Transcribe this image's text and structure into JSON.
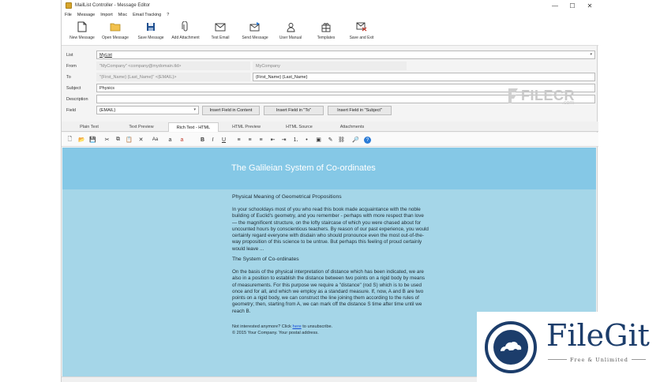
{
  "window": {
    "title": "MailList Controller - Message Editor",
    "controls": [
      "—",
      "☐",
      "✕"
    ]
  },
  "menu": [
    "File",
    "Message",
    "Import",
    "Misc",
    "Email Tracking",
    "?"
  ],
  "toolbar": [
    {
      "label": "New Message",
      "icon": "new-message-icon"
    },
    {
      "label": "Open Message",
      "icon": "open-folder-icon"
    },
    {
      "label": "Save Message",
      "icon": "save-icon"
    },
    {
      "label": "Add Attachment",
      "icon": "paperclip-icon"
    },
    {
      "label": "Test Email",
      "icon": "envelope-icon"
    },
    {
      "label": "Send Message",
      "icon": "send-message-icon"
    },
    {
      "label": "User Manual",
      "icon": "user-manual-icon"
    },
    {
      "label": "Templates",
      "icon": "templates-icon"
    },
    {
      "label": "Save and Exit",
      "icon": "save-exit-icon"
    }
  ],
  "form": {
    "list_label": "List",
    "list_value": "MyList",
    "from_label": "From",
    "from_value": "\"MyCompany\" <company@mydomain.tld>",
    "from_name": "MyCompany",
    "to_label": "To",
    "to_value": "\"{First_Name} {Last_Name}\" <{EMAIL}>",
    "to_name": "{First_Name} {Last_Name}",
    "subject_label": "Subject",
    "subject_value": "Physics",
    "description_label": "Description",
    "description_value": "",
    "field_label": "Field",
    "field_value": "{EMAIL}",
    "btn_insert_content": "Insert Field in Content",
    "btn_insert_to": "Insert Field in \"To\"",
    "btn_insert_subject": "Insert Field in \"Subject\""
  },
  "tabs": [
    "Plain Text",
    "Text Preview",
    "Rich Text - HTML",
    "HTML Preview",
    "HTML Source",
    "Attachments"
  ],
  "active_tab": "Rich Text - HTML",
  "format_toolbar": [
    {
      "name": "new-doc-icon",
      "glyph": "🗋"
    },
    {
      "name": "open-icon",
      "glyph": "📂"
    },
    {
      "name": "save-icon",
      "glyph": "💾"
    },
    {
      "name": "cut-icon",
      "glyph": "✂"
    },
    {
      "name": "copy-icon",
      "glyph": "⧉"
    },
    {
      "name": "paste-icon",
      "glyph": "📋"
    },
    {
      "name": "delete-icon",
      "glyph": "✕"
    },
    {
      "name": "font-size-icon",
      "glyph": "Aa"
    },
    {
      "name": "font-icon",
      "glyph": "a"
    },
    {
      "name": "font-color-icon",
      "glyph": "a"
    },
    {
      "name": "bold-icon",
      "glyph": "B"
    },
    {
      "name": "italic-icon",
      "glyph": "I"
    },
    {
      "name": "underline-icon",
      "glyph": "U"
    },
    {
      "name": "align-left-icon",
      "glyph": "≡"
    },
    {
      "name": "align-center-icon",
      "glyph": "≡"
    },
    {
      "name": "align-right-icon",
      "glyph": "≡"
    },
    {
      "name": "outdent-icon",
      "glyph": "⇤"
    },
    {
      "name": "indent-icon",
      "glyph": "⇥"
    },
    {
      "name": "numbered-list-icon",
      "glyph": "⒈"
    },
    {
      "name": "bullet-list-icon",
      "glyph": "•"
    },
    {
      "name": "image-icon",
      "glyph": "▣"
    },
    {
      "name": "highlight-icon",
      "glyph": "✎"
    },
    {
      "name": "link-icon",
      "glyph": "⛓"
    },
    {
      "name": "spell-icon",
      "glyph": "🔎"
    },
    {
      "name": "help-icon",
      "glyph": "?"
    }
  ],
  "message": {
    "title": "The Galileian System of Co-ordinates",
    "heading1": "Physical Meaning of Geometrical Propositions",
    "para1": "In your schooldays most of you who read this book made acquaintance with the noble building of Euclid's geometry, and you remember - perhaps with more respect than love — the magnificent structure, on the lofty staircase of which you were chased about for uncounted hours by conscientious teachers. By reason of our past experience, you would certainly regard everyone with disdain who should pronounce even the most out-of-the-way proposition of this science to be untrue. But perhaps this feeling of proud certainly would leave ...",
    "heading2": "The System of Co-ordinates",
    "para2": "On the basis of the physical interpretation of distance which has been indicated, we are also in a position to establish the distance between two points on a rigid body by means of measurements. For this purpose we require a \"distance\" (rod S) which is to be used once and for all, and which we employ as a standard measure. If, now, A and B are two points on a rigid body, we can construct the line joining them according to the rules of geometry; then, starting from A, we can mark off the distance S time after time until we reach B.",
    "footer_pre": "Not interested anymore? Click ",
    "footer_link": "here",
    "footer_post": " to unsubscribe.",
    "footer_copy": "© 2015 Your Company. Your postal address."
  },
  "watermarks": {
    "filecr": "FILECR",
    "filecr_com": ".com",
    "filegit": "FileGit",
    "filegit_sub": "Free & Unlimited"
  },
  "colors": {
    "header_band": "#85c8e6",
    "content_bg": "#a5d6e8",
    "link": "#1a4fd6",
    "filegit": "#1c3d6b"
  }
}
